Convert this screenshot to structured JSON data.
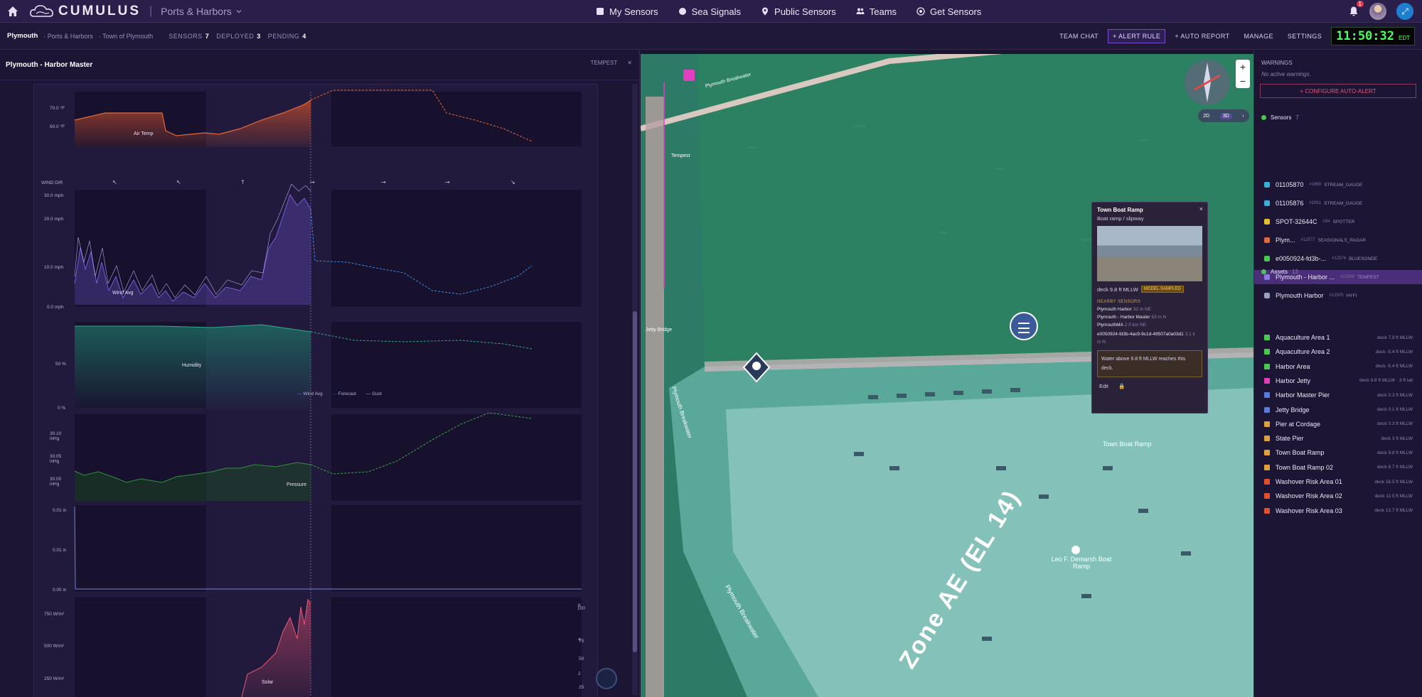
{
  "app": {
    "brand": "CUMULUS",
    "context": "Ports & Harbors"
  },
  "nav": [
    {
      "label": "My Sensors",
      "icon": "square-icon"
    },
    {
      "label": "Sea Signals",
      "icon": "circle-icon"
    },
    {
      "label": "Public Sensors",
      "icon": "pin-icon"
    },
    {
      "label": "Teams",
      "icon": "people-icon"
    },
    {
      "label": "Get Sensors",
      "icon": "target-icon"
    }
  ],
  "notifications": {
    "count": "1"
  },
  "subheader": {
    "location": "Plymouth",
    "crumbs": [
      "Ports & Harbors",
      "Town of Plymouth"
    ],
    "sensors_label": "SENSORS",
    "sensors": "7",
    "deployed_label": "DEPLOYED",
    "deployed": "3",
    "pending_label": "PENDING",
    "pending": "4"
  },
  "actions": {
    "team_chat": "TEAM CHAT",
    "alert_rule": "+ ALERT RULE",
    "auto_report": "+ AUTO REPORT",
    "manage": "MANAGE",
    "settings": "SETTINGS"
  },
  "clock": {
    "time": "11:50:32",
    "zone": "EDT"
  },
  "left_panel": {
    "title": "Plymouth - Harbor Master",
    "type": "TEMPEST"
  },
  "charts": {
    "air_temp": {
      "label": "Air Temp",
      "ticks": [
        "70.0 °F",
        "60.0 °F"
      ]
    },
    "wind_dir": {
      "label": "WIND DIR"
    },
    "wind": {
      "label": "Wind Avg",
      "ticks": [
        "30.0 mph",
        "20.0 mph",
        "10.0 mph",
        "0.0 mph"
      ],
      "legend": [
        "Wind Avg",
        "Forecast",
        "Gust"
      ]
    },
    "humidity": {
      "label": "Humidity",
      "ticks": [
        "50 %",
        "0 %"
      ]
    },
    "pressure": {
      "label": "Pressure",
      "ticks": [
        "30.10 inHg",
        "30.05 inHg",
        "30.00 inHg"
      ]
    },
    "rain": {
      "ticks": [
        "0.01 in",
        "0.01 in",
        "0.00 in"
      ]
    },
    "solar": {
      "label": "Solar",
      "ticks": [
        "750 W/m²",
        "500 W/m²",
        "250 W/m²"
      ],
      "right_ticks": [
        "100",
        "75",
        "50",
        "25"
      ],
      "uv_ticks": [
        "6",
        "4",
        "2"
      ]
    }
  },
  "map": {
    "labels": [
      "Plymouth Breakwater",
      "Plymouth Breakwater",
      "Plymouth Breakwater",
      "Town Boat Ramp",
      "Leo F. Demarsh Boat Ramp",
      "Zone AE (EL 14)",
      "Jetty Bridge",
      "Tempest"
    ],
    "mode": {
      "two_d": "2D",
      "three_d": "3D"
    }
  },
  "popup": {
    "title": "Town Boat Ramp",
    "subtitle": "Boat ramp / slipway",
    "deck": "deck 9.8 ft MLLW",
    "badge": "MODEL-SAMPLED",
    "nearby_label": "NEARBY SENSORS",
    "nearby": [
      {
        "name": "Plymouth Harbor",
        "dist": "32 m NE"
      },
      {
        "name": "Plymouth - Harbor Master",
        "dist": "63 m N"
      },
      {
        "name": "PlymouthMA",
        "dist": "2.0 km NE"
      },
      {
        "name": "e0050924-fd3b-4ac9-9c1d-49507a0a03d1",
        "dist": "3.1 km N"
      }
    ],
    "warning": "Water above 9.8 ft MLLW reaches this deck.",
    "edit": "Edit"
  },
  "right_panel": {
    "warnings_title": "WARNINGS",
    "no_warnings": "No active warnings.",
    "configure": "+ CONFIGURE AUTO-ALERT",
    "sensors_title": "Sensors",
    "sensors_count": "7",
    "sensors": [
      {
        "name": "01105870",
        "id": "#1969",
        "type": "STREAM_GAUGE",
        "color": "#3ab0d8"
      },
      {
        "name": "01105876",
        "id": "#1961",
        "type": "STREAM_GAUGE",
        "color": "#3ab0d8"
      },
      {
        "name": "SPOT-32644C",
        "id": "#94",
        "type": "SPOTTER",
        "color": "#e0c030"
      },
      {
        "name": "Plym...",
        "id": "#12577",
        "type": "SEASIGNALS_RADAR",
        "color": "#e06a3a"
      },
      {
        "name": "e0050924-fd3b-...",
        "id": "#12576",
        "type": "BLUESONDE",
        "color": "#4ac850"
      },
      {
        "name": "Plymouth - Harbor ...",
        "id": "#12999",
        "type": "TEMPEST",
        "color": "#8a7ae0"
      },
      {
        "name": "Plymouth Harbor",
        "id": "#12505",
        "type": "HYFI",
        "color": "#9aa0c0"
      }
    ],
    "assets_title": "Assets",
    "assets_count": "13",
    "assets": [
      {
        "name": "Aquaculture Area 1",
        "deck": "deck 7.9 ft MLLW",
        "color": "#4ac850"
      },
      {
        "name": "Aquaculture Area 2",
        "deck": "deck -5.4 ft MLLW",
        "color": "#4ac850"
      },
      {
        "name": "Harbor Area",
        "deck": "deck -5.4 ft MLLW",
        "color": "#4ac850"
      },
      {
        "name": "Harbor Jetty",
        "deck": "deck 9.8 ft MLLW · 3 ft tall",
        "color": "#e040c0"
      },
      {
        "name": "Harbor Master Pier",
        "deck": "deck 0.3 ft MLLW",
        "color": "#5a7ae0"
      },
      {
        "name": "Jetty Bridge",
        "deck": "deck 0.1 ft MLLW",
        "color": "#5a7ae0"
      },
      {
        "name": "Pier at Cordage",
        "deck": "deck 0.3 ft MLLW",
        "color": "#e0a040"
      },
      {
        "name": "State Pier",
        "deck": "deck 3 ft MLLW",
        "color": "#e0a040"
      },
      {
        "name": "Town Boat Ramp",
        "deck": "deck 9.8 ft MLLW",
        "color": "#e0a040"
      },
      {
        "name": "Town Boat Ramp 02",
        "deck": "deck 6.7 ft MLLW",
        "color": "#e0a040"
      },
      {
        "name": "Washover Risk Area 01",
        "deck": "deck 16.5 ft MLLW",
        "color": "#e05030"
      },
      {
        "name": "Washover Risk Area 02",
        "deck": "deck 11.5 ft MLLW",
        "color": "#e05030"
      },
      {
        "name": "Washover Risk Area 03",
        "deck": "deck 13.7 ft MLLW",
        "color": "#e05030"
      }
    ]
  }
}
